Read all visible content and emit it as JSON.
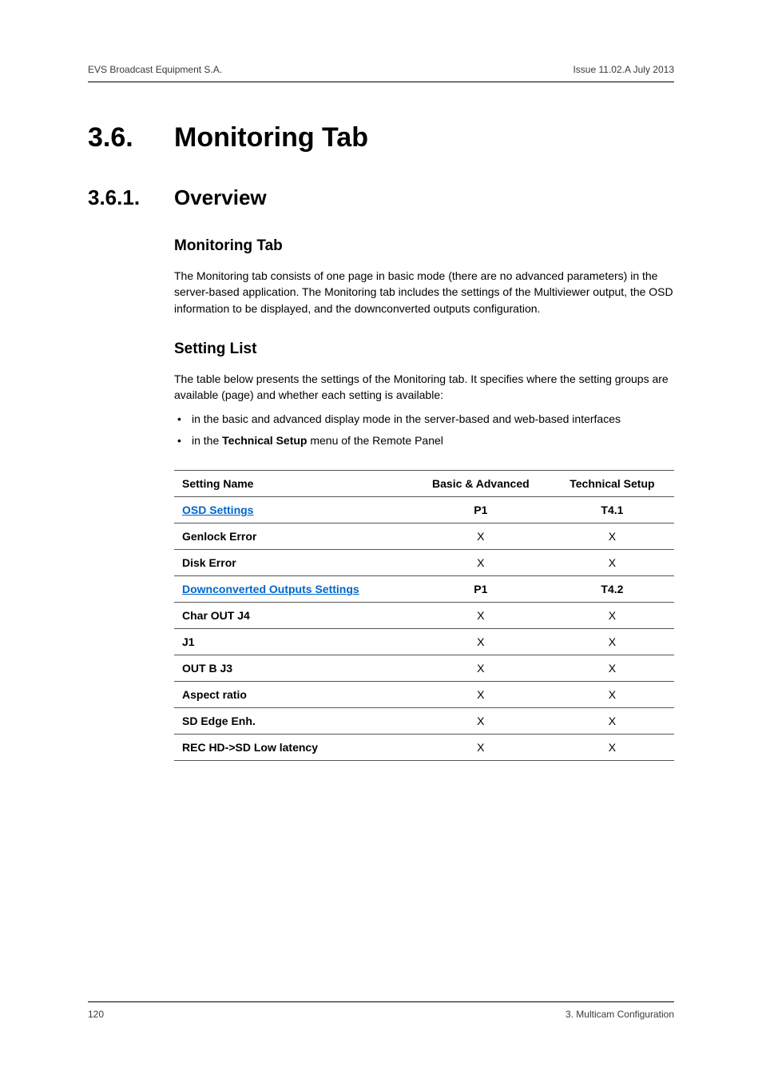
{
  "header": {
    "left": "EVS Broadcast Equipment S.A.",
    "right": "Issue 11.02.A  July 2013"
  },
  "section": {
    "number": "3.6.",
    "title": "Monitoring Tab"
  },
  "subsection": {
    "number": "3.6.1.",
    "title": "Overview"
  },
  "block1": {
    "heading": "Monitoring Tab",
    "paragraph": "The Monitoring tab consists of one page in basic mode (there are no advanced parameters) in the server-based application. The Monitoring tab includes the settings of the Multiviewer output, the OSD information to be displayed, and the downconverted outputs configuration."
  },
  "block2": {
    "heading": "Setting List",
    "intro": "The table below presents the settings of the Monitoring tab. It specifies where the setting groups are available (page) and whether each setting is available:",
    "bullets": [
      {
        "text": "in the basic and advanced display mode in the server-based and web-based interfaces"
      },
      {
        "prefix": "in the ",
        "bold": "Technical Setup",
        "suffix": " menu of the Remote Panel"
      }
    ]
  },
  "table": {
    "headers": [
      "Setting Name",
      "Basic & Advanced",
      "Technical Setup"
    ],
    "rows": [
      {
        "type": "section",
        "name": "OSD Settings",
        "basic": "P1",
        "tech": "T4.1"
      },
      {
        "type": "item",
        "name": "Genlock Error",
        "basic": "X",
        "tech": "X"
      },
      {
        "type": "item",
        "name": "Disk Error",
        "basic": "X",
        "tech": "X"
      },
      {
        "type": "section",
        "name": "Downconverted Outputs Settings",
        "basic": "P1",
        "tech": "T4.2"
      },
      {
        "type": "item",
        "name": "Char OUT J4",
        "basic": "X",
        "tech": "X"
      },
      {
        "type": "item",
        "name": "J1",
        "basic": "X",
        "tech": "X"
      },
      {
        "type": "item",
        "name": "OUT B J3",
        "basic": "X",
        "tech": "X"
      },
      {
        "type": "item",
        "name": "Aspect ratio",
        "basic": "X",
        "tech": "X"
      },
      {
        "type": "item",
        "name": "SD Edge Enh.",
        "basic": "X",
        "tech": "X"
      },
      {
        "type": "item",
        "name": "REC HD->SD Low latency",
        "basic": "X",
        "tech": "X"
      }
    ]
  },
  "footer": {
    "left": "120",
    "right": "3. Multicam Configuration"
  }
}
